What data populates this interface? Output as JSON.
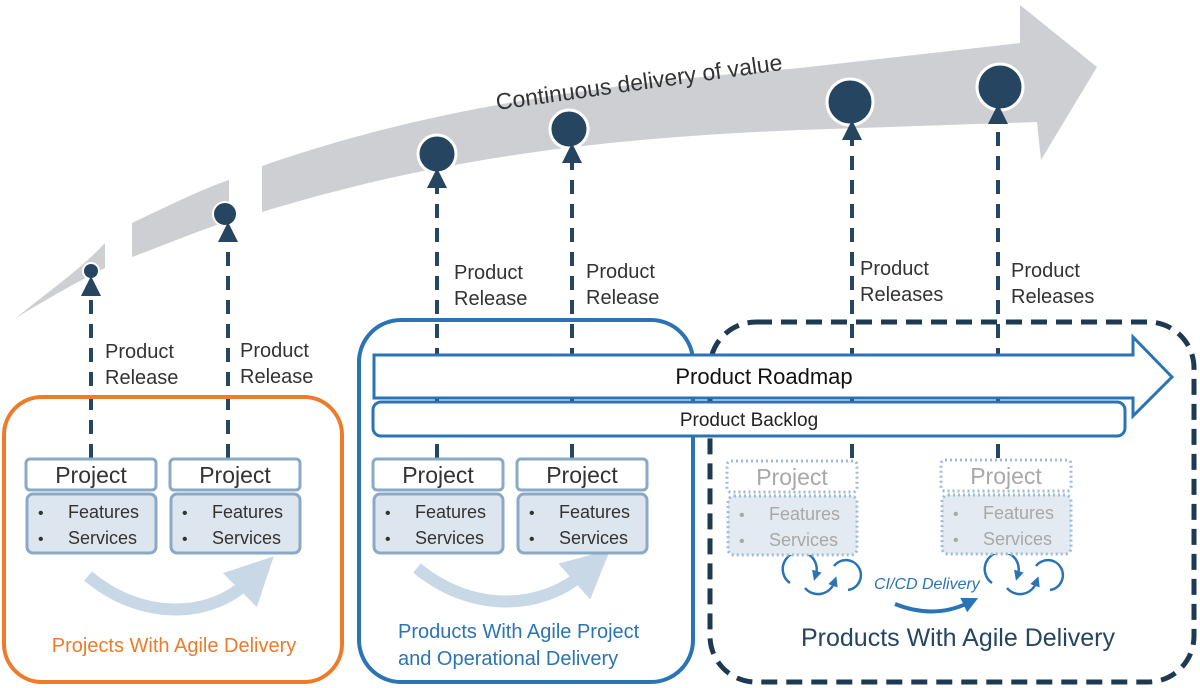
{
  "colors": {
    "navy": "#264560",
    "grey_arrow": "#cdcfd3",
    "orange": "#ee7b2a",
    "blue": "#2a74b6",
    "project_border": "#8aa9c4",
    "project_fill": "#dde6ee"
  },
  "value_arrow": {
    "label": "Continuous delivery of value"
  },
  "releases": [
    {
      "label_line1": "Product",
      "label_line2": "Release"
    },
    {
      "label_line1": "Product",
      "label_line2": "Release"
    },
    {
      "label_line1": "Product",
      "label_line2": "Release"
    },
    {
      "label_line1": "Product",
      "label_line2": "Release"
    },
    {
      "label_line1": "Product",
      "label_line2": "Releases"
    },
    {
      "label_line1": "Product",
      "label_line2": "Releases"
    }
  ],
  "roadmap": {
    "label": "Product Roadmap"
  },
  "backlog": {
    "label": "Product Backlog"
  },
  "groups": [
    {
      "title_lines": [
        "Projects With Agile Delivery"
      ],
      "projects": [
        {
          "title": "Project",
          "items": [
            "Features",
            "Services"
          ]
        },
        {
          "title": "Project",
          "items": [
            "Features",
            "Services"
          ]
        }
      ]
    },
    {
      "title_lines": [
        "Products With Agile Project",
        "and Operational Delivery"
      ],
      "projects": [
        {
          "title": "Project",
          "items": [
            "Features",
            "Services"
          ]
        },
        {
          "title": "Project",
          "items": [
            "Features",
            "Services"
          ]
        }
      ]
    },
    {
      "title_lines": [
        "Products With Agile Delivery"
      ],
      "projects": [
        {
          "title": "Project",
          "items": [
            "Features",
            "Services"
          ]
        },
        {
          "title": "Project",
          "items": [
            "Features",
            "Services"
          ]
        }
      ],
      "cicd_label": "CI/CD Delivery"
    }
  ],
  "bullet": "•"
}
